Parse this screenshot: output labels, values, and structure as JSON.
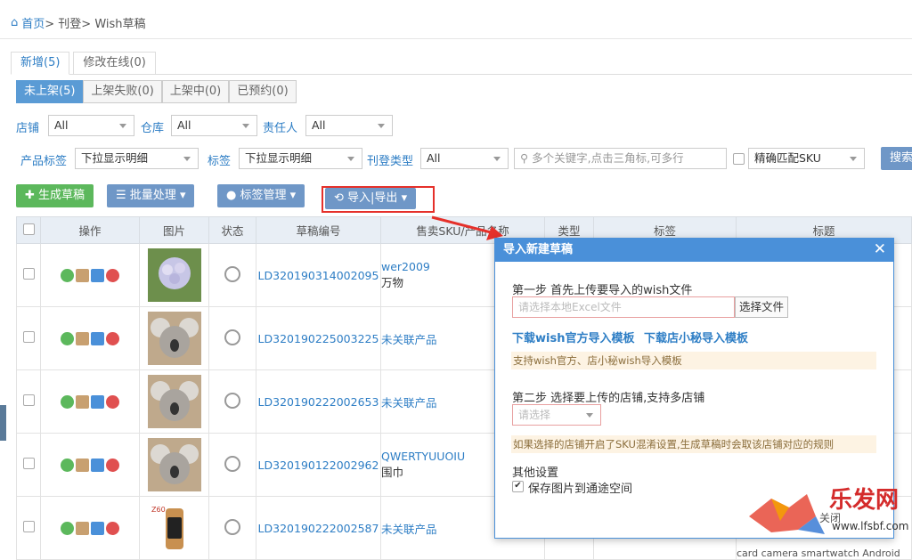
{
  "breadcrumb": {
    "home": "首页",
    "path": " > 刊登> Wish草稿"
  },
  "tabs": [
    {
      "label": "新增(5)"
    },
    {
      "label": "修改在线(0)"
    }
  ],
  "subtabs": [
    {
      "label": "未上架(5)"
    },
    {
      "label": "上架失败(0)"
    },
    {
      "label": "上架中(0)"
    },
    {
      "label": "已预约(0)"
    }
  ],
  "filters": {
    "shop_label": "店铺",
    "shop_value": "All",
    "warehouse_label": "仓库",
    "warehouse_value": "All",
    "owner_label": "责任人",
    "owner_value": "All",
    "product_tag_label": "产品标签",
    "product_tag_value": "下拉显示明细",
    "tag_label": "标签",
    "tag_value": "下拉显示明细",
    "type_label": "刊登类型",
    "type_value": "All",
    "keyword_placeholder": "多个关键字,点击三角标,可多行",
    "exact_sku_label": "精确匹配SKU",
    "search_label": "搜索"
  },
  "toolbar": {
    "create": "生成草稿",
    "batch": "批量处理",
    "tag_manage": "标签管理",
    "import_export": "导入|导出"
  },
  "table": {
    "headers": [
      "操作",
      "图片",
      "状态",
      "草稿编号",
      "售卖SKU/产品名称",
      "类型",
      "标签",
      "标题"
    ],
    "rows": [
      {
        "code": "LD320190314002095",
        "sku": "wer2009",
        "name": "万物",
        "image": "flower"
      },
      {
        "code": "LD320190225003225",
        "sku": "未关联产品",
        "name": "",
        "image": "koala"
      },
      {
        "code": "LD320190222002653",
        "sku": "未关联产品",
        "name": "",
        "image": "koala"
      },
      {
        "code": "LD320190122002962",
        "sku": "QWERTYUUOIU",
        "name": "围巾",
        "image": "koala"
      },
      {
        "code": "LD320190222002587",
        "sku": "未关联产品",
        "name": "",
        "image": "watch"
      }
    ],
    "row5_title_snippet": "card camera smartwatch Android"
  },
  "modal": {
    "title": "导入新建草稿",
    "step1": "第一步 首先上传要导入的wish文件",
    "file_placeholder": "请选择本地Excel文件",
    "choose_file": "选择文件",
    "link_official": "下载wish官方导入模板",
    "link_shop": "下载店小秘导入模板",
    "note1": "支持wish官方、店小秘wish导入模板",
    "step2": "第二步 选择要上传的店铺,支持多店铺",
    "store_placeholder": "请选择",
    "note2": "如果选择的店铺开启了SKU混淆设置,生成草稿时会取该店铺对应的规则",
    "other": "其他设置",
    "save_images": "保存图片到通途空间"
  },
  "footer": {
    "close": "关闭"
  },
  "watermark": {
    "text": "乐发网",
    "url": "www.lfsbf.com"
  }
}
